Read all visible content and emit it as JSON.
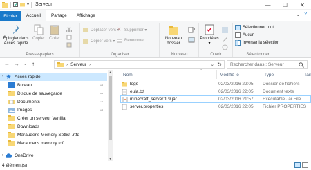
{
  "window": {
    "title": "Serveur",
    "minimize": "—",
    "maximize": "☐",
    "close": "✕",
    "expand_ribbon": "⌄",
    "help": "?"
  },
  "tabs": {
    "file": "Fichier",
    "home": "Accueil",
    "share": "Partage",
    "view": "Affichage"
  },
  "ribbon": {
    "clipboard": {
      "pin_label": "Épingler dans\nAccès rapide",
      "copy_label": "Copier",
      "paste_label": "Coller",
      "group_label": "Presse-papiers"
    },
    "organize": {
      "move_label": "Déplacer vers ▾",
      "copy_to_label": "Copier vers ▾",
      "delete_label": "Supprimer ▾",
      "rename_label": "Renommer",
      "group_label": "Organiser"
    },
    "new": {
      "new_folder_label": "Nouveau\ndossier",
      "group_label": "Nouveau"
    },
    "open": {
      "properties_label": "Propriétés\n▾",
      "group_label": "Ouvrir"
    },
    "select": {
      "select_all": "Sélectionner tout",
      "select_none": "Aucun",
      "invert": "Inverser la sélection",
      "group_label": "Sélectionner"
    }
  },
  "address": {
    "crumb_root": "›",
    "crumb": "Serveur",
    "crumb_arrow": "›",
    "dropdown": "⌄",
    "refresh": "↻",
    "search_placeholder": "Rechercher dans : Serveur"
  },
  "nav": {
    "back": "←",
    "forward": "→",
    "recent": "⌄",
    "up": "↑",
    "items": [
      {
        "label": "Accès rapide",
        "expander": "›"
      },
      {
        "label": "Bureau",
        "pin": "📌"
      },
      {
        "label": "Disque de sauvegarde",
        "pin": "📌"
      },
      {
        "label": "Documents",
        "pin": "📌"
      },
      {
        "label": "Images",
        "pin": "📌"
      },
      {
        "label": "Créer un serveur Vanilla"
      },
      {
        "label": "Downloads"
      },
      {
        "label": "Marauder's Memory Setlist .rtfd"
      },
      {
        "label": "Marauder's memory tof"
      },
      {
        "label": "OneDrive",
        "expander": "›"
      }
    ]
  },
  "columns": {
    "name": "Nom",
    "date": "Modifié le",
    "type": "Type",
    "size": "Taille",
    "sort_arrow": "^"
  },
  "files": [
    {
      "name": "logs",
      "date": "02/03/2016 22:05",
      "type": "Dossier de fichiers",
      "icon": "folder-icon"
    },
    {
      "name": "eula.txt",
      "date": "02/03/2016 22:05",
      "type": "Document texte",
      "icon": "text-file-icon"
    },
    {
      "name": "minecraft_server.1.9.jar",
      "date": "02/03/2016 21:57",
      "type": "Executable Jar File",
      "icon": "jar-file-icon"
    },
    {
      "name": "server.properties",
      "date": "02/03/2016 22:05",
      "type": "Fichier PROPERTIES",
      "icon": "file-icon"
    }
  ],
  "status": {
    "count": "4 élément(s)"
  },
  "colors": {
    "accent": "#1979ca",
    "selection": "#cce8ff",
    "folder": "#f8d775"
  }
}
